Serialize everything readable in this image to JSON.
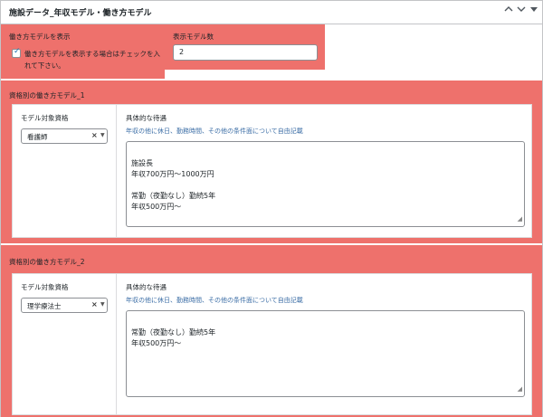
{
  "metabox": {
    "title": "施設データ_年収モデル・働き方モデル",
    "up_icon": "chevron-up-icon",
    "down_icon": "chevron-down-icon",
    "toggle_icon": "collapse-toggle-icon"
  },
  "show_model": {
    "label": "働き方モデルを表示",
    "checkbox_checked": true,
    "checkbox_label": "働き方モデルを表示する場合はチェックを入れて下さい。"
  },
  "model_count": {
    "label": "表示モデル数",
    "value": "2"
  },
  "models": [
    {
      "title": "資格別の働き方モデル_1",
      "qualification_label": "モデル対象資格",
      "qualification_value": "看護師",
      "treatment_label": "具体的な待遇",
      "treatment_desc": "年収の他に休日、勤務時間、その他の条件面について自由記載",
      "treatment_text": "施設長\n年収700万円〜1000万円\n\n常勤（夜勤なし）勤続5年\n年収500万円〜"
    },
    {
      "title": "資格別の働き方モデル_2",
      "qualification_label": "モデル対象資格",
      "qualification_value": "理学療法士",
      "treatment_label": "具体的な待遇",
      "treatment_desc": "年収の他に休日、勤務時間、その他の条件面について自由記載",
      "treatment_text": "常勤（夜勤なし）勤続5年\n年収500万円〜"
    }
  ],
  "colors": {
    "accent": "#ee716c",
    "link_text": "#3c6ea6"
  }
}
